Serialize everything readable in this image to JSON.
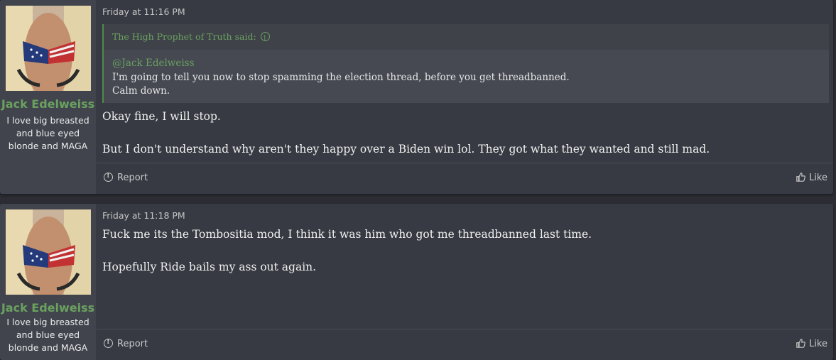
{
  "posts": [
    {
      "user": {
        "name": "Jack Edelweiss",
        "title": "I love big breasted and blue eyed blonde and MAGA"
      },
      "date": "Friday at 11:16 PM",
      "quote": {
        "author_line": "The High Prophet of Truth said:",
        "mention": "@Jack Edelweiss",
        "line1": "I'm going to tell you now to stop spamming the election thread, before you get threadbanned.",
        "line2": "Calm down."
      },
      "paragraphs": [
        "Okay fine, I will stop.",
        "But I don't understand why aren't they happy over a Biden win lol. They got what they wanted and still mad."
      ],
      "report_label": "Report",
      "like_label": "Like"
    },
    {
      "user": {
        "name": "Jack Edelweiss",
        "title": "I love big breasted and blue eyed blonde and MAGA"
      },
      "date": "Friday at 11:18 PM",
      "paragraphs": [
        "Fuck me its the Tombositia mod, I think it was him who got me threadbanned last time.",
        "Hopefully Ride bails my ass out again."
      ],
      "report_label": "Report",
      "like_label": "Like"
    }
  ],
  "colors": {
    "username": "#6aa15f",
    "quote_border": "#4f8b48",
    "post_bg": "#373a42",
    "user_cell_bg": "#41444d"
  },
  "icons": {
    "report": "report-icon",
    "like": "thumbs-up-icon",
    "quote_jump": "arrow-up-circle-icon"
  }
}
